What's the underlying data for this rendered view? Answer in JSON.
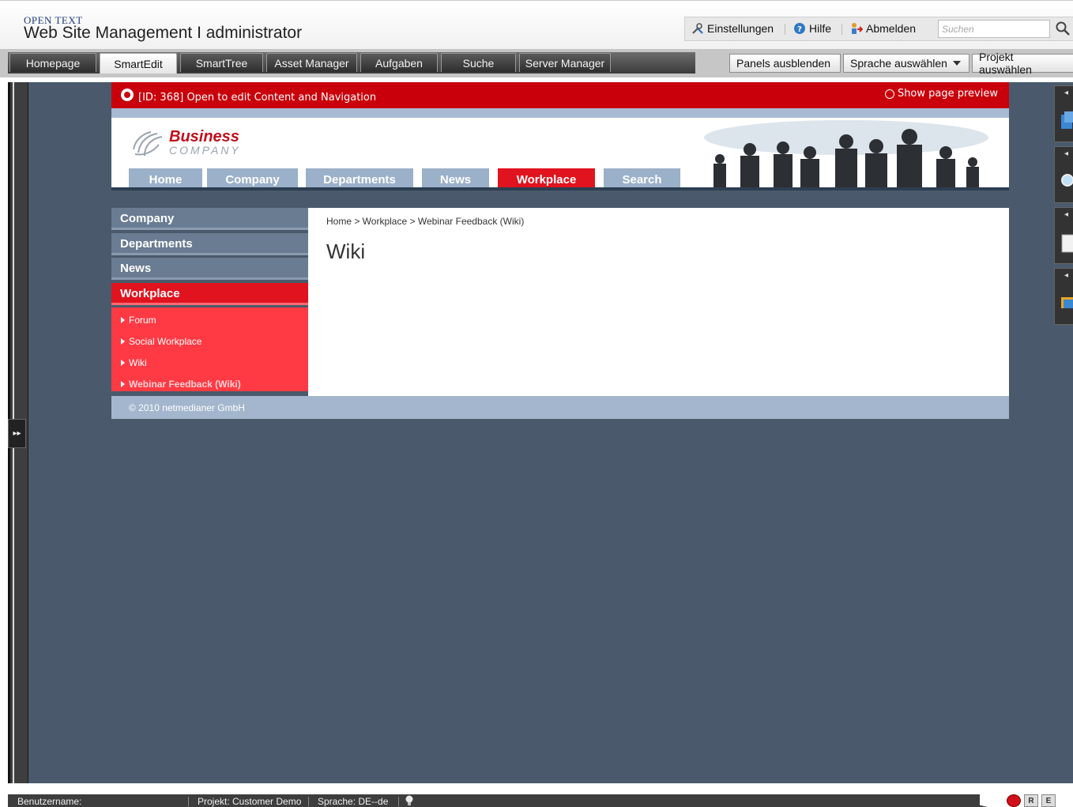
{
  "app": {
    "brand": "OPEN TEXT",
    "product": "Web Site Management  I  administrator"
  },
  "header_tools": {
    "settings": "Einstellungen",
    "help": "Hilfe",
    "logout": "Abmelden",
    "search_placeholder": "Suchen"
  },
  "tabs": [
    {
      "label": "Homepage",
      "active": false
    },
    {
      "label": "SmartEdit",
      "active": true
    },
    {
      "label": "SmartTree",
      "active": false
    },
    {
      "label": "Asset Manager",
      "active": false
    },
    {
      "label": "Aufgaben",
      "active": false
    },
    {
      "label": "Suche",
      "active": false
    },
    {
      "label": "Server Manager",
      "active": false
    }
  ],
  "toolbar_right": {
    "hide_panels": "Panels ausblenden",
    "select_language": "Sprache auswählen",
    "select_project": "Projekt auswählen"
  },
  "edit_banner": {
    "text": "[ID: 368] Open to edit Content and Navigation",
    "preview": "Show page preview"
  },
  "site": {
    "logo_word": "Business",
    "logo_sub": "COMPANY",
    "top_nav": [
      "Home",
      "Company",
      "Departments",
      "News",
      "Workplace",
      "Search"
    ],
    "top_nav_active": "Workplace",
    "side_nav": [
      "Company",
      "Departments",
      "News",
      "Workplace"
    ],
    "side_nav_active": "Workplace",
    "sub_nav": [
      "Forum",
      "Social Workplace",
      "Wiki",
      "Webinar Feedback (Wiki)"
    ],
    "sub_nav_current": "Webinar Feedback (Wiki)",
    "breadcrumb": "Home > Workplace > Webinar Feedback (Wiki)",
    "page_title": "Wiki",
    "footer": "© 2010 netmedianer GmbH"
  },
  "status": {
    "username": "Benutzername:",
    "project": "Projekt: Customer Demo",
    "language": "Sprache: DE--de"
  },
  "colors": {
    "accent_red": "#e0131e",
    "banner_red": "#c9000b",
    "workspace": "#4a5a6c",
    "nav_blue": "#9bb0c9"
  },
  "icons": [
    "tools-icon",
    "help-icon",
    "logout-icon",
    "magnifier-icon",
    "expand-panel-icon",
    "lightbulb-icon"
  ]
}
